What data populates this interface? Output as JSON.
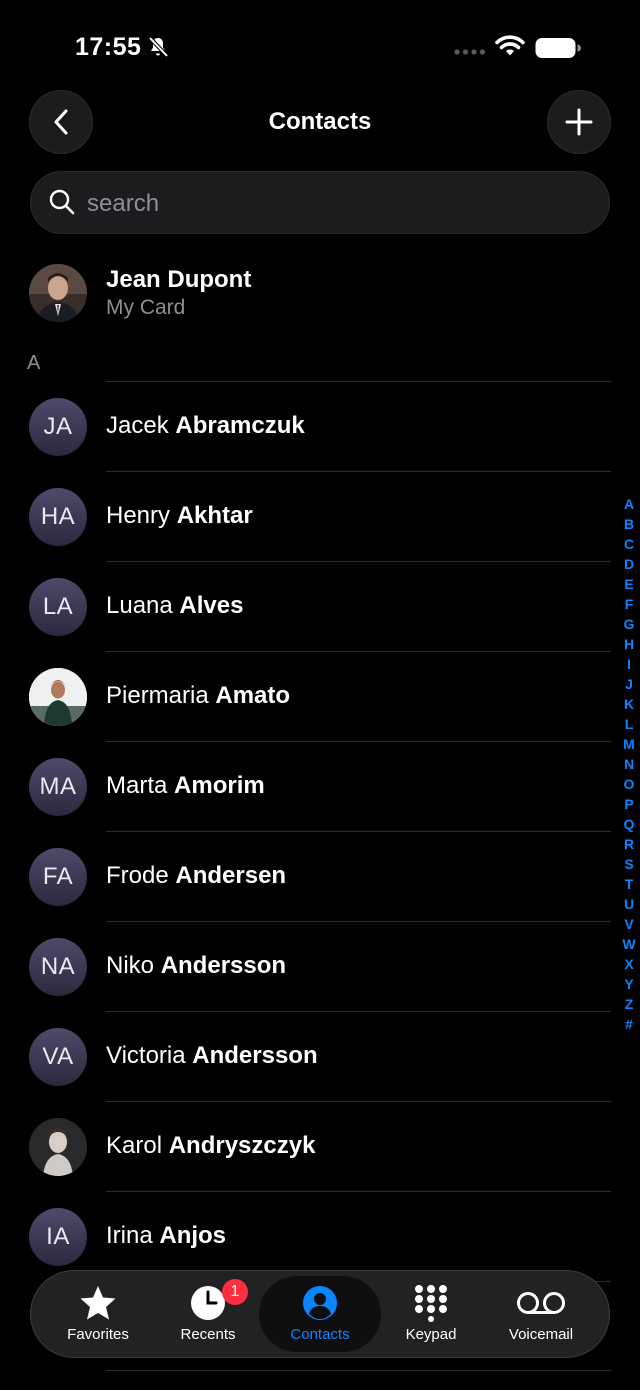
{
  "status": {
    "time": "17:55"
  },
  "nav": {
    "title": "Contacts"
  },
  "search": {
    "placeholder": "search"
  },
  "my_card": {
    "name": "Jean Dupont",
    "subtitle": "My Card"
  },
  "section": {
    "header": "A"
  },
  "contacts": [
    {
      "initials": "JA",
      "first": "Jacek",
      "last": "Abramczuk",
      "photo": false
    },
    {
      "initials": "HA",
      "first": "Henry",
      "last": "Akhtar",
      "photo": false
    },
    {
      "initials": "LA",
      "first": "Luana",
      "last": "Alves",
      "photo": false
    },
    {
      "initials": "",
      "first": "Piermaria",
      "last": "Amato",
      "photo": true
    },
    {
      "initials": "MA",
      "first": "Marta",
      "last": "Amorim",
      "photo": false
    },
    {
      "initials": "FA",
      "first": "Frode",
      "last": "Andersen",
      "photo": false
    },
    {
      "initials": "NA",
      "first": "Niko",
      "last": "Andersson",
      "photo": false
    },
    {
      "initials": "VA",
      "first": "Victoria",
      "last": "Andersson",
      "photo": false
    },
    {
      "initials": "",
      "first": "Karol",
      "last": "Andryszczyk",
      "photo": true
    },
    {
      "initials": "IA",
      "first": "Irina",
      "last": "Anjos",
      "photo": false
    }
  ],
  "index_letters": [
    "A",
    "B",
    "C",
    "D",
    "E",
    "F",
    "G",
    "H",
    "I",
    "J",
    "K",
    "L",
    "M",
    "N",
    "O",
    "P",
    "Q",
    "R",
    "S",
    "T",
    "U",
    "V",
    "W",
    "X",
    "Y",
    "Z",
    "#"
  ],
  "tabs": {
    "favorites": "Favorites",
    "recents": "Recents",
    "recents_badge": "1",
    "contacts": "Contacts",
    "keypad": "Keypad",
    "voicemail": "Voicemail"
  },
  "colors": {
    "accent": "#0a84ff",
    "badge": "#ff2d40",
    "background": "#000000"
  }
}
